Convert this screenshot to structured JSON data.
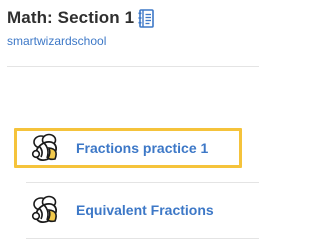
{
  "header": {
    "title": "Math: Section 1",
    "owner": "smartwizardschool",
    "icon": "notebook-icon"
  },
  "activities": [
    {
      "label": "Fractions practice 1",
      "icon": "bee-icon",
      "selected": true
    },
    {
      "label": "Equivalent Fractions",
      "icon": "bee-icon",
      "selected": false
    }
  ],
  "colors": {
    "title": "#2f2f2f",
    "link": "#3d78c7",
    "highlight_border": "#f5c33b",
    "bee_wing": "#f2c94c",
    "divider": "#e4e4e4"
  }
}
